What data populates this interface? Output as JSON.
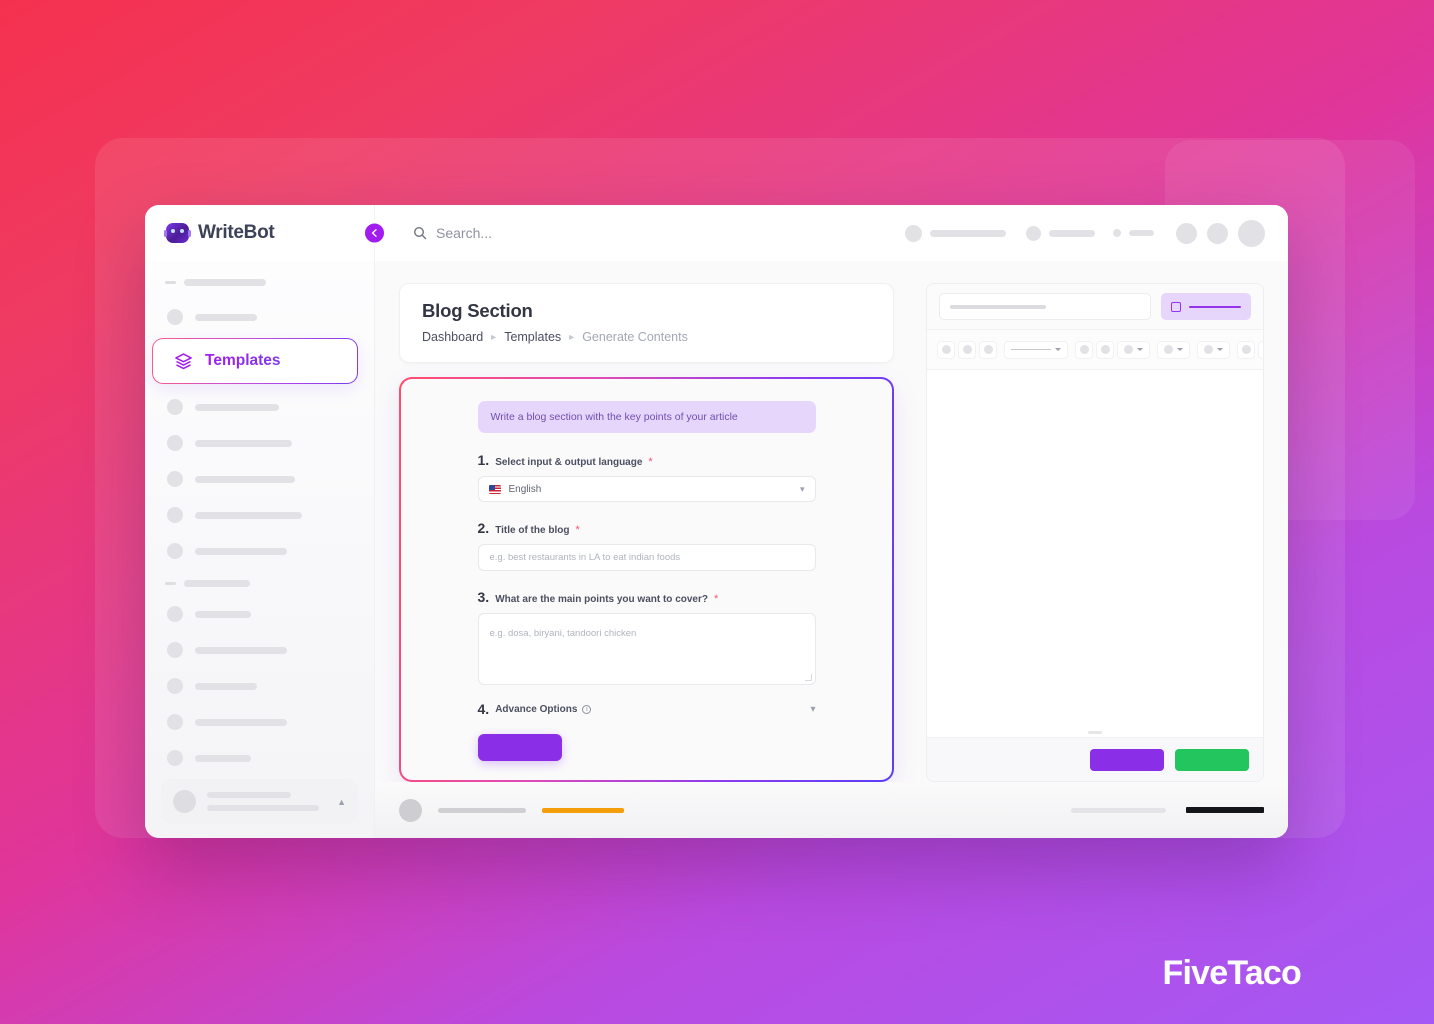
{
  "brand": {
    "name": "WriteBot",
    "logo_icon": "robot-icon"
  },
  "topbar": {
    "collapse_icon": "chevron-left-icon",
    "search_icon": "search-icon",
    "search_placeholder": "Search..."
  },
  "sidebar": {
    "active_item": {
      "label": "Templates",
      "icon": "layers-icon"
    }
  },
  "page": {
    "title": "Blog Section",
    "breadcrumb": [
      {
        "label": "Dashboard",
        "current": false
      },
      {
        "label": "Templates",
        "current": false
      },
      {
        "label": "Generate Contents",
        "current": true
      }
    ],
    "breadcrumb_separator": "▸"
  },
  "form": {
    "prompt_banner": "Write a blog section with the key points of your article",
    "fields": [
      {
        "num": "1.",
        "label": "Select input & output language",
        "required": "*",
        "type": "select",
        "value": "English",
        "flag": "us-flag-icon",
        "chevron": "chevron-down-icon"
      },
      {
        "num": "2.",
        "label": "Title of the blog",
        "required": "*",
        "type": "text",
        "placeholder": "e.g. best restaurants in LA to eat indian foods"
      },
      {
        "num": "3.",
        "label": "What are the main points you want to cover?",
        "required": "*",
        "type": "textarea",
        "placeholder": "e.g. dosa, biryani, tandoori chicken"
      },
      {
        "num": "4.",
        "label": "Advance Options",
        "required": "",
        "type": "accordion",
        "info_icon": "info-icon",
        "chevron": "chevron-down-icon"
      }
    ],
    "generate_button_label": ""
  },
  "editor": {
    "chip_icon": "square-icon",
    "primary_button_label": "",
    "secondary_button_label": ""
  },
  "colors": {
    "accent_purple": "#8b2ee8",
    "accent_green": "#22c55e",
    "accent_orange": "#f59e0b",
    "brand_gradient_start": "#ff4d6d",
    "brand_gradient_end": "#5b3ef5",
    "background_start": "#f5314f",
    "background_end": "#a558f5"
  },
  "watermark": {
    "text": "FiveTaco"
  }
}
